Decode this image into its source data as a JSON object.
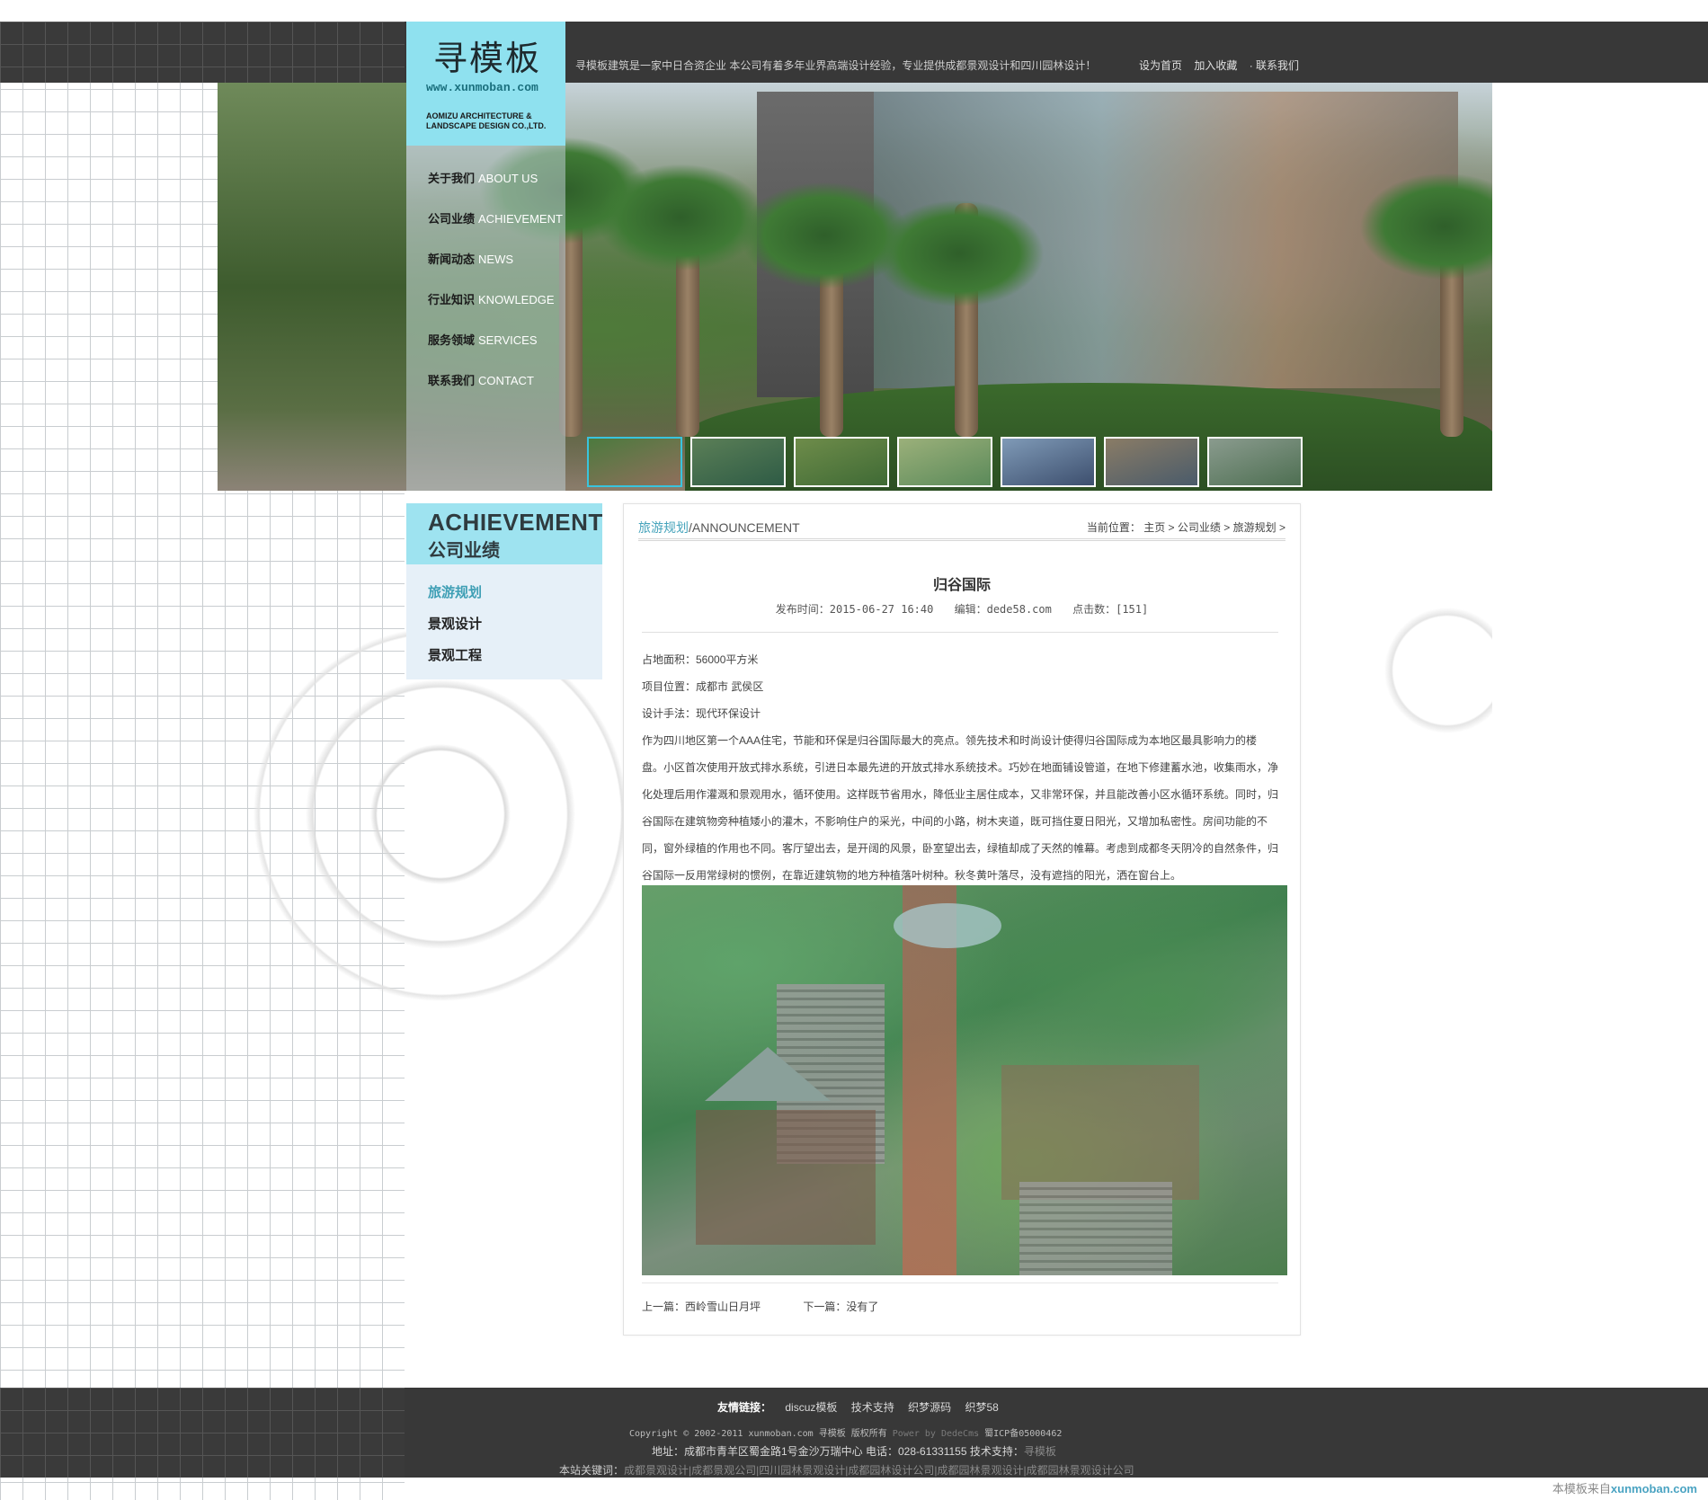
{
  "header": {
    "logo_cn": "寻模板",
    "logo_url": "www.xunmoban.com",
    "logo_en_line1": "AOMIZU ARCHITECTURE &",
    "logo_en_line2": "LANDSCAPE DESIGN CO.,LTD.",
    "intro": "寻模板建筑是一家中日合资企业 本公司有着多年业界高端设计经验，专业提供成都景观设计和四川园林设计！",
    "links": [
      "设为首页",
      "加入收藏",
      "· 联系我们"
    ]
  },
  "nav": [
    {
      "cn": "关于我们",
      "en": "ABOUT US"
    },
    {
      "cn": "公司业绩",
      "en": "ACHIEVEMENT"
    },
    {
      "cn": "新闻动态",
      "en": "NEWS"
    },
    {
      "cn": "行业知识",
      "en": "KNOWLEDGE"
    },
    {
      "cn": "服务领域",
      "en": "SERVICES"
    },
    {
      "cn": "联系我们",
      "en": "CONTACT"
    }
  ],
  "sidebar": {
    "title_en": "ACHIEVEMENT",
    "title_cn": "公司业绩",
    "items": [
      "旅游规划",
      "景观设计",
      "景观工程"
    ],
    "active_index": 0
  },
  "content": {
    "category_cn": "旅游规划",
    "category_en": "/ANNOUNCEMENT",
    "crumb_label": "当前位置：",
    "crumbs": [
      "主页",
      "公司业绩",
      "旅游规划"
    ],
    "crumb_sep": ">",
    "title": "归谷国际",
    "meta_date": "发布时间：2015-06-27 16:40",
    "meta_editor": "编辑：dede58.com",
    "meta_clicks": "点击数：[151]",
    "paragraphs": [
      "占地面积：56000平方米",
      "项目位置：成都市 武侯区",
      "设计手法：现代环保设计",
      "作为四川地区第一个AAA住宅，节能和环保是归谷国际最大的亮点。领先技术和时尚设计使得归谷国际成为本地区最具影响力的楼盘。小区首次使用开放式排水系统，引进日本最先进的开放式排水系统技术。巧妙在地面铺设管道，在地下修建蓄水池，收集雨水，净化处理后用作灌溉和景观用水，循环使用。这样既节省用水，降低业主居住成本，又非常环保，并且能改善小区水循环系统。同时，归谷国际在建筑物旁种植矮小的灌木，不影响住户的采光，中间的小路，树木夹道，既可挡住夏日阳光，又增加私密性。房间功能的不同，窗外绿植的作用也不同。客厅望出去，是开阔的风景，卧室望出去，绿植却成了天然的帷幕。考虑到成都冬天阴冷的自然条件，归谷国际一反用常绿树的惯例，在靠近建筑物的地方种植落叶树种。秋冬黄叶落尽，没有遮挡的阳光，洒在窗台上。"
    ],
    "prev": "上一篇：西岭雪山日月坪",
    "next": "下一篇：没有了"
  },
  "footer": {
    "friend_label": "友情链接：",
    "friend_links": [
      "discuz模板",
      "技术支持",
      "织梦源码",
      "织梦58"
    ],
    "copyright": "Copyright © 2002-2011 xunmoban.com 寻模板 版权所有",
    "power": "Power by DedeCms",
    "icp": "蜀ICP备05000462",
    "address": "地址：成都市青羊区蜀金路1号金沙万瑞中心 电话：028-61331155 技术支持：",
    "support": "寻模板",
    "keywords_label": "本站关键词：",
    "keywords": "成都景观设计|成都景观公司|四川园林景观设计|成都园林设计公司|成都园林景观设计|成都园林景观设计公司",
    "watermark_pre": "本模板来自",
    "watermark_site": "xunmoban.com"
  },
  "colors": {
    "accent": "#8fe1ef",
    "topbar": "#383838",
    "link_active": "#45a3bb"
  }
}
